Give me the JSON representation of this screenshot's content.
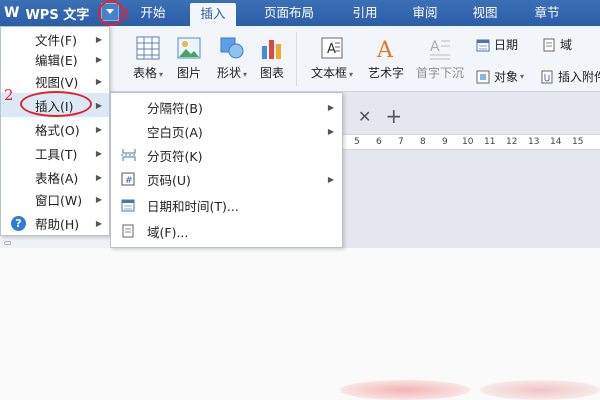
{
  "app": {
    "logo": "W",
    "name": "WPS 文字"
  },
  "tabs": [
    {
      "label": "开始",
      "active": false
    },
    {
      "label": "插入",
      "active": true
    },
    {
      "label": "页面布局",
      "active": false
    },
    {
      "label": "引用",
      "active": false
    },
    {
      "label": "审阅",
      "active": false
    },
    {
      "label": "视图",
      "active": false
    },
    {
      "label": "章节",
      "active": false
    }
  ],
  "ribbon": {
    "table": "表格",
    "picture": "图片",
    "shape": "形状",
    "chart": "图表",
    "textbox": "文本框",
    "wordart": "艺术字",
    "dropcap": "首字下沉",
    "date": "日期",
    "field": "域",
    "object": "对象",
    "attachment": "插入附件"
  },
  "main_menu": [
    {
      "label": "文件(F)",
      "arrow": true
    },
    {
      "label": "编辑(E)",
      "arrow": true
    },
    {
      "label": "视图(V)",
      "arrow": true
    },
    {
      "label": "插入(I)",
      "arrow": true,
      "highlighted": true
    },
    {
      "label": "格式(O)",
      "arrow": true
    },
    {
      "label": "工具(T)",
      "arrow": true
    },
    {
      "label": "表格(A)",
      "arrow": true
    },
    {
      "label": "窗口(W)",
      "arrow": true
    },
    {
      "label": "帮助(H)",
      "arrow": true
    }
  ],
  "insert_submenu": [
    {
      "label": "分隔符(B)",
      "arrow": true,
      "icon": ""
    },
    {
      "label": "空白页(A)",
      "arrow": true,
      "icon": ""
    },
    {
      "label": "分页符(K)",
      "arrow": false,
      "icon": "page-break-icon"
    },
    {
      "label": "页码(U)",
      "arrow": true,
      "icon": "page-number-icon"
    },
    {
      "label": "日期和时间(T)...",
      "arrow": false,
      "icon": "calendar-icon"
    },
    {
      "label": "域(F)...",
      "arrow": false,
      "icon": "field-icon"
    }
  ],
  "ruler_numbers": [
    "5",
    "6",
    "7",
    "8",
    "9",
    "10",
    "11",
    "12",
    "13",
    "14",
    "15"
  ],
  "annotations": {
    "step1": "1",
    "step2": "2"
  },
  "colors": {
    "title_bar": "#2b5ea7",
    "annotation": "#e2242a",
    "menu_highlight": "#dbe8f7"
  }
}
